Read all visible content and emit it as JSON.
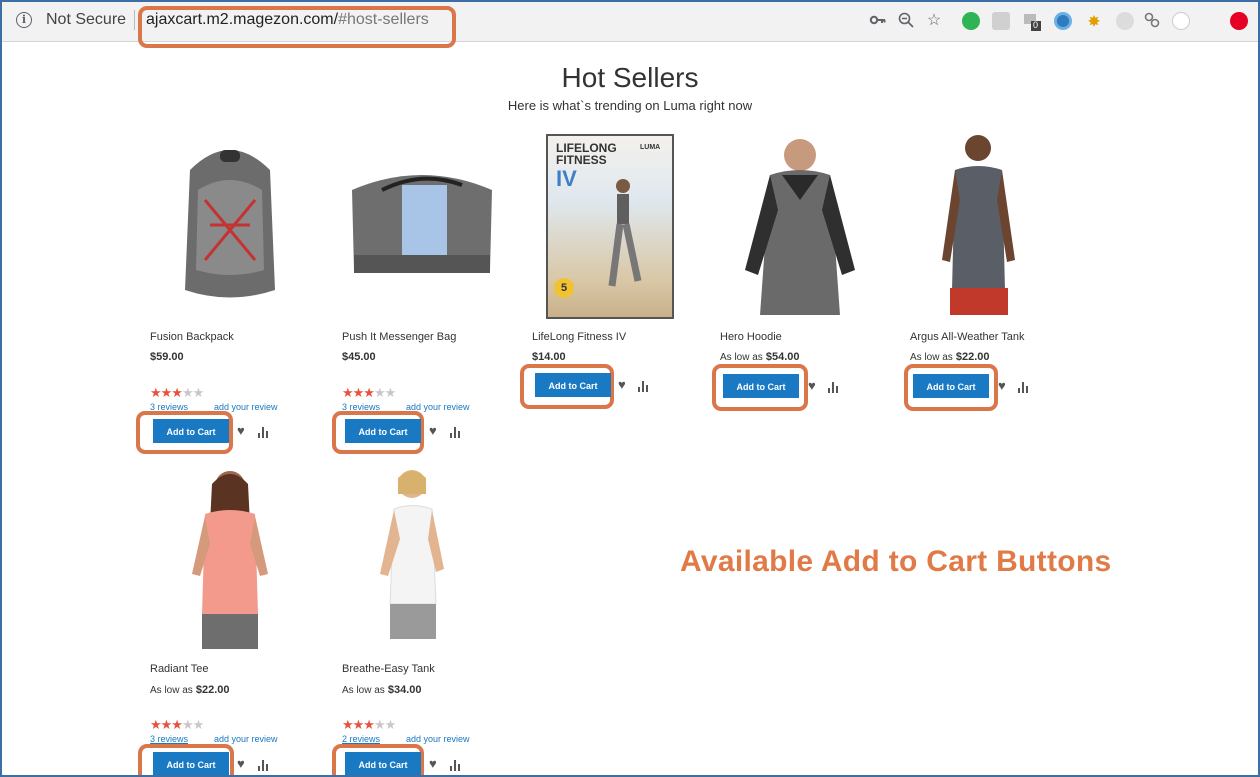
{
  "browser": {
    "security_label": "Not Secure",
    "url_host": "ajaxcart.m2.magezon.com/",
    "url_path": "#host-sellers",
    "extension_badge": "0"
  },
  "page": {
    "title": "Hot Sellers",
    "subtitle": "Here is what`s trending on Luma right now"
  },
  "products": [
    {
      "name": "Fusion Backpack",
      "price_prefix": "",
      "price": "$59.00",
      "rating": 3.5,
      "reviews": "3  reviews",
      "add_review": "add your review",
      "button": "Add to Cart"
    },
    {
      "name": "Push It Messenger Bag",
      "price_prefix": "",
      "price": "$45.00",
      "rating": 3.5,
      "reviews": "3  reviews",
      "add_review": "add your review",
      "button": "Add to Cart"
    },
    {
      "name": "LifeLong Fitness IV",
      "price_prefix": "",
      "price": "$14.00",
      "button": "Add to Cart"
    },
    {
      "name": "Hero Hoodie",
      "price_prefix": "As low as",
      "price": "$54.00",
      "button": "Add to Cart"
    },
    {
      "name": "Argus All-Weather Tank",
      "price_prefix": "As low as",
      "price": "$22.00",
      "button": "Add to Cart"
    },
    {
      "name": "Radiant Tee",
      "price_prefix": "As low as",
      "price": "$22.00",
      "rating": 3,
      "reviews": "3  reviews",
      "add_review": "add your review",
      "button": "Add to Cart"
    },
    {
      "name": "Breathe-Easy Tank",
      "price_prefix": "As low as",
      "price": "$34.00",
      "rating": 3.5,
      "reviews": "2  reviews",
      "add_review": "add your review",
      "button": "Add to Cart"
    }
  ],
  "dvd_cover": {
    "line1": "LIFELONG",
    "line2": "FITNESS",
    "line3": "IV",
    "brand": "LUMA",
    "badge": "5"
  },
  "callout": "Available Add to Cart Buttons",
  "colors": {
    "accent_orange": "#d9774a",
    "button_blue": "#1979c3",
    "star_red": "#e8513e"
  }
}
